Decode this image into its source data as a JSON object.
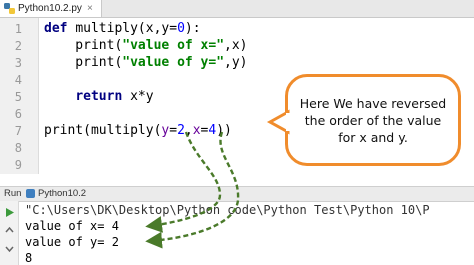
{
  "editor": {
    "tab_title": "Python10.2.py",
    "line_numbers": [
      "1",
      "2",
      "3",
      "4",
      "5",
      "6",
      "7",
      "8",
      "9"
    ],
    "lines": [
      {
        "segments": [
          {
            "t": "def ",
            "c": "kw"
          },
          {
            "t": "multiply(x,y=",
            "c": ""
          },
          {
            "t": "0",
            "c": "num"
          },
          {
            "t": "):",
            "c": ""
          }
        ]
      },
      {
        "segments": [
          {
            "t": "    print(",
            "c": ""
          },
          {
            "t": "\"value of x=\"",
            "c": "str"
          },
          {
            "t": ",x)",
            "c": ""
          }
        ]
      },
      {
        "segments": [
          {
            "t": "    print(",
            "c": ""
          },
          {
            "t": "\"value of y=\"",
            "c": "str"
          },
          {
            "t": ",y)",
            "c": ""
          }
        ]
      },
      {
        "segments": [
          {
            "t": "",
            "c": ""
          }
        ]
      },
      {
        "segments": [
          {
            "t": "    ",
            "c": ""
          },
          {
            "t": "return ",
            "c": "kw"
          },
          {
            "t": "x*y",
            "c": ""
          }
        ]
      },
      {
        "segments": [
          {
            "t": "",
            "c": ""
          }
        ]
      },
      {
        "segments": [
          {
            "t": "print(multiply(",
            "c": ""
          },
          {
            "t": "y",
            "c": "kwarg"
          },
          {
            "t": "=",
            "c": ""
          },
          {
            "t": "2",
            "c": "num"
          },
          {
            "t": ",",
            "c": ""
          },
          {
            "t": "x",
            "c": "kwarg"
          },
          {
            "t": "=",
            "c": ""
          },
          {
            "t": "4",
            "c": "num"
          },
          {
            "t": "))",
            "c": ""
          }
        ]
      },
      {
        "segments": [
          {
            "t": "",
            "c": ""
          }
        ]
      },
      {
        "segments": [
          {
            "t": "",
            "c": ""
          }
        ]
      }
    ]
  },
  "callout": {
    "text": "Here We have reversed the order of the value for x and y."
  },
  "run_panel": {
    "label": "Run",
    "tab_title": "Python10.2",
    "output": [
      "\"C:\\Users\\DK\\Desktop\\Python code\\Python Test\\Python 10\\P",
      "value of x= 4",
      "value of y= 2",
      "8"
    ]
  },
  "colors": {
    "accent_orange": "#f08c2c",
    "arrow_green": "#4a7a2a",
    "run_green": "#3c9a3c"
  }
}
